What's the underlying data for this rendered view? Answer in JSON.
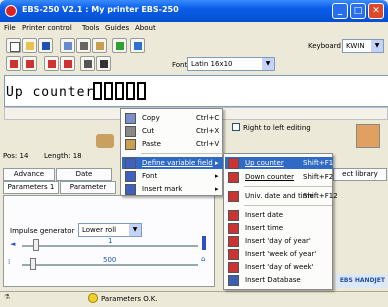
{
  "window": {
    "title": "EBS-250 V2.1 : My printer EBS-250",
    "min": "_",
    "max": "□",
    "close": "✕"
  },
  "menubar": [
    "File",
    "Printer control",
    "Tools",
    "Guides",
    "About"
  ],
  "toolbar": {
    "keyboard_label": "Keyboard",
    "keyboard_value": "KWIN",
    "font_label": "Font",
    "font_value": "Latin 16x10"
  },
  "editor": {
    "text": "Up counter:"
  },
  "status_row": {
    "pos_label": "Pos: 14",
    "length_label": "Length: 18",
    "right_to_left": "Right to left editing"
  },
  "tabs_row1": [
    "Advance",
    "Date",
    "ect library"
  ],
  "tabs_row2": [
    "Parameters 1",
    "Parameter"
  ],
  "panel": {
    "impulse_label": "Impulse generator",
    "impulse_value": "Lower roll",
    "slider1_value": "1",
    "slider2_value": "500"
  },
  "statusbar": {
    "text": "Parameters O.K."
  },
  "brand": {
    "text": "EBS HANDJET"
  },
  "context_menu": [
    {
      "label": "Copy",
      "shortcut": "Ctrl+C"
    },
    {
      "label": "Cut",
      "shortcut": "Ctrl+X"
    },
    {
      "label": "Paste",
      "shortcut": "Ctrl+V"
    },
    {
      "label": "Define variable field",
      "shortcut": ""
    },
    {
      "label": "Font",
      "shortcut": ""
    },
    {
      "label": "Insert mark",
      "shortcut": ""
    }
  ],
  "submenu": [
    {
      "label": "Up counter",
      "shortcut": "Shift+F1"
    },
    {
      "label": "Down counter",
      "shortcut": "Shift+F2"
    },
    {
      "label": "Univ. date and time",
      "shortcut": "Shift+F12"
    },
    {
      "label": "Insert date",
      "shortcut": ""
    },
    {
      "label": "Insert time",
      "shortcut": ""
    },
    {
      "label": "Insert 'day of year'",
      "shortcut": ""
    },
    {
      "label": "Insert 'week of year'",
      "shortcut": ""
    },
    {
      "label": "Insert 'day of week'",
      "shortcut": ""
    },
    {
      "label": "Insert Database",
      "shortcut": ""
    }
  ],
  "colors": {
    "titlebar": "#0a5ce8",
    "highlight": "#316ac5",
    "menu_bg": "#fcfcfa"
  }
}
